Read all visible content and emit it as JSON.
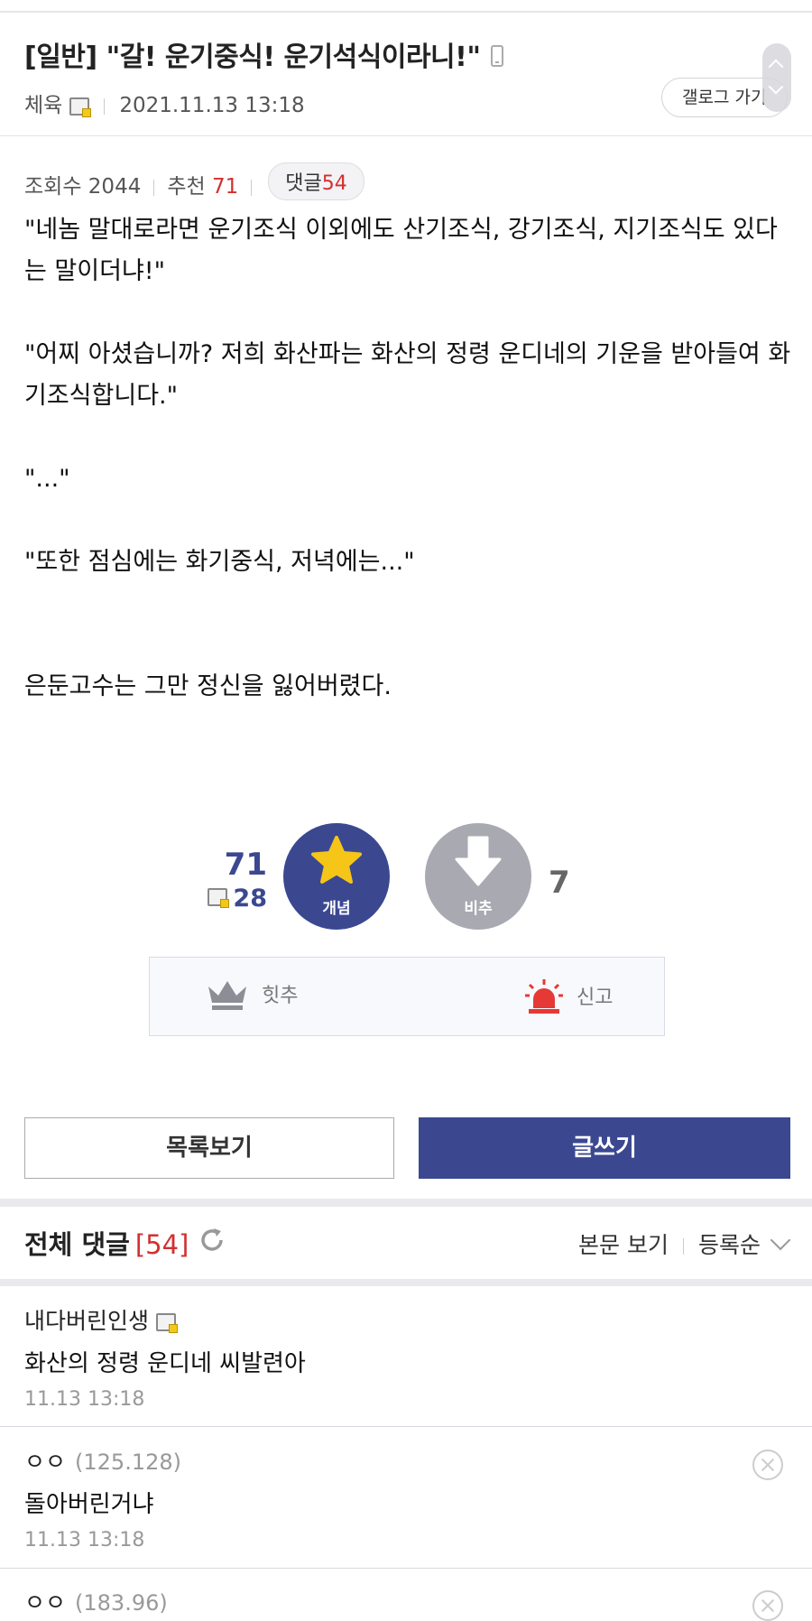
{
  "post": {
    "title": "[일반] \"갈! 운기중식! 운기석식이라니!\"",
    "author": "체육",
    "date": "2021.11.13 13:18",
    "gallog_label": "갤로그 가기",
    "views_label": "조회수",
    "views": "2044",
    "recommend_label": "추천",
    "recommend": "71",
    "comments_label": "댓글",
    "comments": "54",
    "body": [
      "\"네놈 말대로라면 운기조식 이외에도 산기조식, 강기조식, 지기조식도 있다는 말이더냐!\"",
      "\"어찌 아셨습니까? 저희 화산파는 화산의 정령 운디네의 기운을 받아들여 화기조식합니다.\"",
      "\"...\"",
      "\"또한 점심에는 화기중식, 저녁에는...\"",
      "은둔고수는 그만 정신을 잃어버렸다."
    ]
  },
  "vote": {
    "up_count": "71",
    "fixed_up_count": "28",
    "up_label": "개념",
    "down_label": "비추",
    "down_count": "7",
    "hit_label": "힛추",
    "report_label": "신고"
  },
  "buttons": {
    "list": "목록보기",
    "write": "글쓰기"
  },
  "comments_section": {
    "title": "전체 댓글",
    "count": "[54]",
    "view_body": "본문 보기",
    "sort": "등록순"
  },
  "comments": [
    {
      "author": "내다버린인생",
      "ip": "",
      "text": "화산의 정령 운디네 씨발련아",
      "date": "11.13 13:18"
    },
    {
      "author": "ㅇㅇ",
      "ip": "(125.128)",
      "text": "돌아버린거냐",
      "date": "11.13 13:18"
    },
    {
      "author": "ㅇㅇ",
      "ip": "(183.96)",
      "text": "",
      "date": ""
    }
  ],
  "colors": {
    "accent": "#3b4890",
    "red": "#d32f2f",
    "downvote": "#a9a9b2",
    "star": "#f5c518"
  }
}
